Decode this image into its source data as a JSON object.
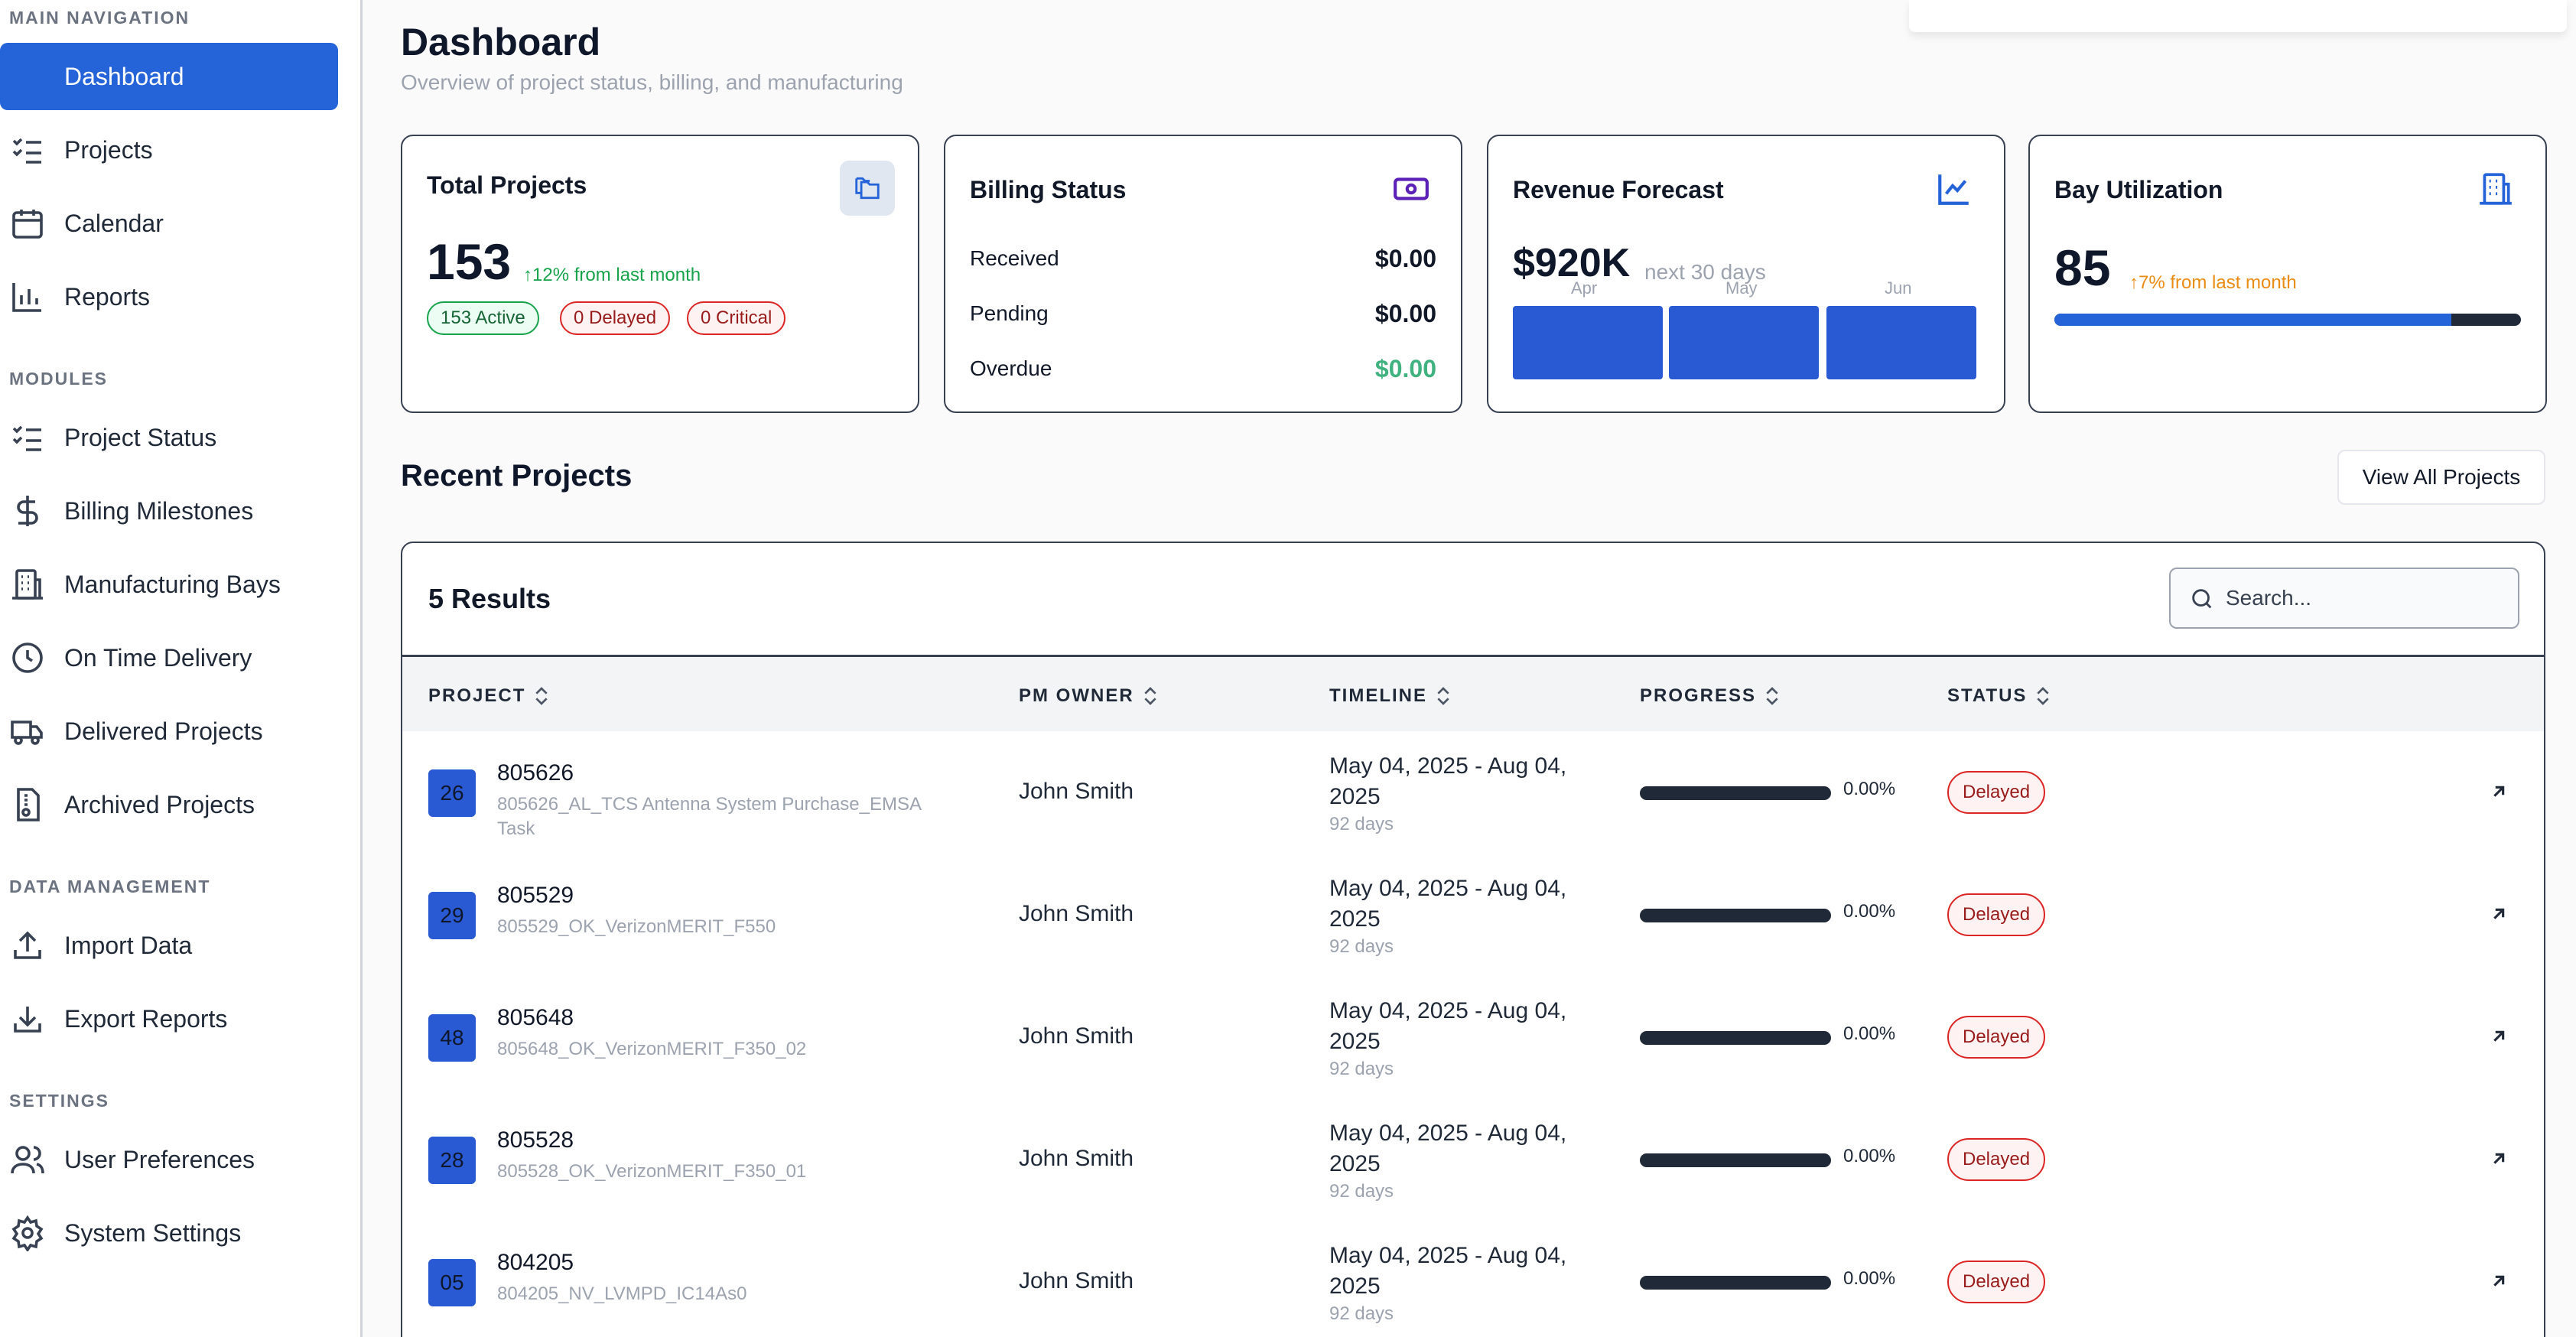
{
  "sidebar": {
    "sections": [
      {
        "title": "MAIN NAVIGATION",
        "items": [
          {
            "label": "Dashboard",
            "icon": "dashboard-icon",
            "active": true
          },
          {
            "label": "Projects",
            "icon": "checklist-icon"
          },
          {
            "label": "Calendar",
            "icon": "calendar-icon"
          },
          {
            "label": "Reports",
            "icon": "bar-chart-icon"
          }
        ]
      },
      {
        "title": "MODULES",
        "items": [
          {
            "label": "Project Status",
            "icon": "checklist-icon"
          },
          {
            "label": "Billing Milestones",
            "icon": "dollar-icon"
          },
          {
            "label": "Manufacturing Bays",
            "icon": "building-icon"
          },
          {
            "label": "On Time Delivery",
            "icon": "clock-icon"
          },
          {
            "label": "Delivered Projects",
            "icon": "truck-icon"
          },
          {
            "label": "Archived Projects",
            "icon": "archive-icon"
          }
        ]
      },
      {
        "title": "DATA MANAGEMENT",
        "items": [
          {
            "label": "Import Data",
            "icon": "upload-icon"
          },
          {
            "label": "Export Reports",
            "icon": "download-icon"
          }
        ]
      },
      {
        "title": "SETTINGS",
        "items": [
          {
            "label": "User Preferences",
            "icon": "users-icon"
          },
          {
            "label": "System Settings",
            "icon": "gear-icon"
          }
        ]
      }
    ]
  },
  "header": {
    "title": "Dashboard",
    "subtitle": "Overview of project status, billing, and manufacturing"
  },
  "cards": {
    "total_projects": {
      "title": "Total Projects",
      "value": "153",
      "trend": "12% from last month",
      "pills": {
        "active": "153 Active",
        "delayed": "0 Delayed",
        "critical": "0 Critical"
      }
    },
    "billing": {
      "title": "Billing Status",
      "rows": [
        {
          "label": "Received",
          "value": "$0.00"
        },
        {
          "label": "Pending",
          "value": "$0.00"
        },
        {
          "label": "Overdue",
          "value": "$0.00"
        }
      ]
    },
    "revenue": {
      "title": "Revenue Forecast",
      "value": "$920K",
      "note": "next 30 days",
      "months": [
        "Apr",
        "May",
        "Jun"
      ]
    },
    "bay": {
      "title": "Bay Utilization",
      "value": "85",
      "trend": "7% from last month",
      "utilization_fraction": 0.85
    }
  },
  "recent": {
    "title": "Recent Projects",
    "view_all": "View All Projects",
    "results": "5 Results",
    "search_placeholder": "Search...",
    "columns": [
      "PROJECT",
      "PM OWNER",
      "TIMELINE",
      "PROGRESS",
      "STATUS"
    ],
    "rows": [
      {
        "badge": "26",
        "id": "805626",
        "desc": "805626_AL_TCS Antenna System Purchase_EMSA Task",
        "owner": "John Smith",
        "timeline": "May 04, 2025 - Aug 04, 2025",
        "days": "92 days",
        "progress": "0.00%",
        "status": "Delayed"
      },
      {
        "badge": "29",
        "id": "805529",
        "desc": "805529_OK_VerizonMERIT_F550",
        "owner": "John Smith",
        "timeline": "May 04, 2025 - Aug 04, 2025",
        "days": "92 days",
        "progress": "0.00%",
        "status": "Delayed"
      },
      {
        "badge": "48",
        "id": "805648",
        "desc": "805648_OK_VerizonMERIT_F350_02",
        "owner": "John Smith",
        "timeline": "May 04, 2025 - Aug 04, 2025",
        "days": "92 days",
        "progress": "0.00%",
        "status": "Delayed"
      },
      {
        "badge": "28",
        "id": "805528",
        "desc": "805528_OK_VerizonMERIT_F350_01",
        "owner": "John Smith",
        "timeline": "May 04, 2025 - Aug 04, 2025",
        "days": "92 days",
        "progress": "0.00%",
        "status": "Delayed"
      },
      {
        "badge": "05",
        "id": "804205",
        "desc": "804205_NV_LVMPD_IC14As0",
        "owner": "John Smith",
        "timeline": "May 04, 2025 - Aug 04, 2025",
        "days": "92 days",
        "progress": "0.00%",
        "status": "Delayed"
      }
    ]
  },
  "colors": {
    "accent": "#2563d9",
    "trend_up": "#16a34a",
    "trend_warn": "#ea8c14",
    "danger": "#dc2626",
    "overdue_value": "#3fb27f"
  }
}
